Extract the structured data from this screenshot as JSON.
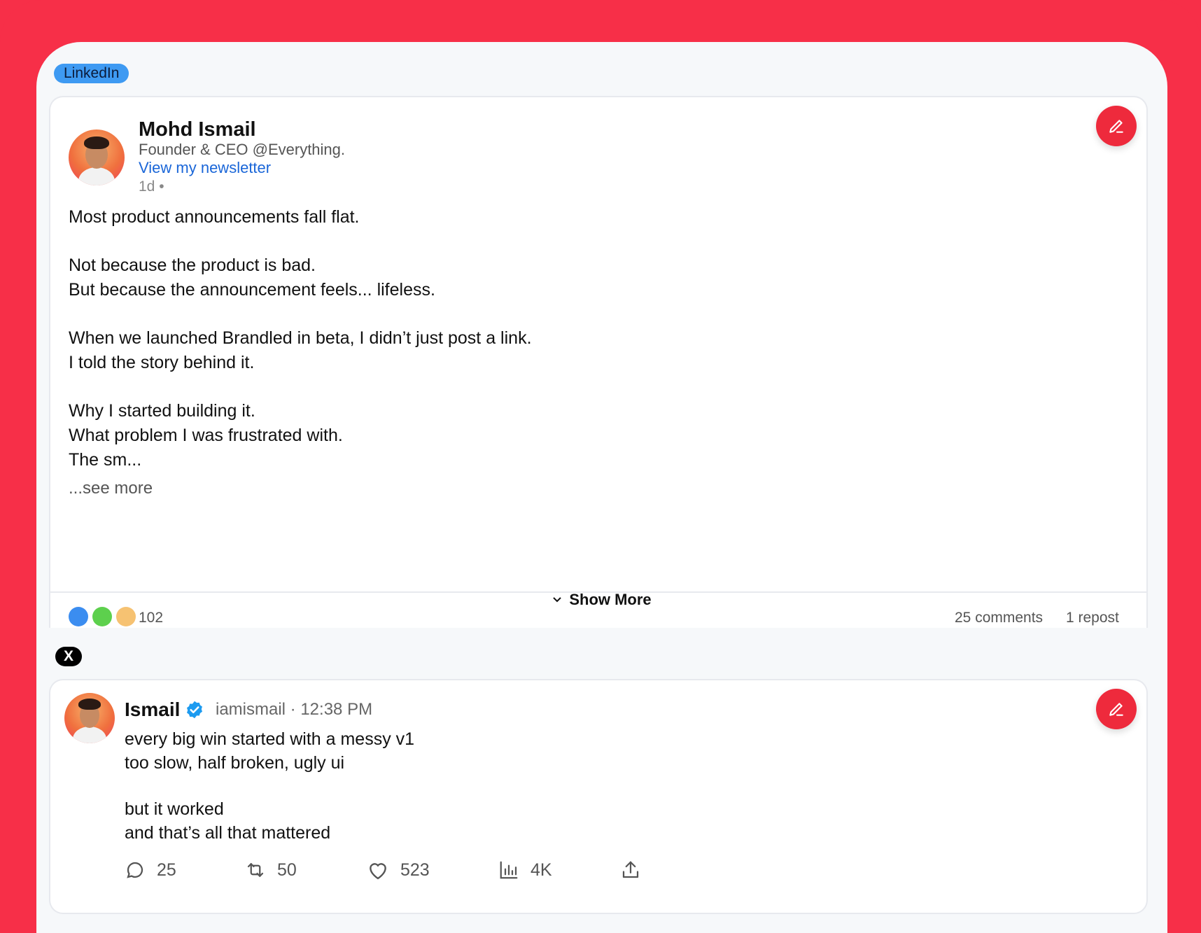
{
  "linkedin": {
    "badge": "LinkedIn",
    "author": "Mohd Ismail",
    "headline": "Founder & CEO @Everything.",
    "newsletter_link": "View my newsletter",
    "time": "1d •",
    "body": [
      "Most product announcements fall flat.",
      "",
      "Not because the product is bad.",
      "But because the announcement feels... lifeless.",
      "",
      "When we launched Brandled in beta, I didn’t just post a link.",
      "I told the story behind it.",
      "",
      "Why I started building it.",
      "What problem I was frustrated with.",
      "The sm..."
    ],
    "see_more": "...see more",
    "reactions_count": "102",
    "comments": "25 comments",
    "reposts": "1 repost",
    "reaction_colors": [
      "#3B8DF0",
      "#5DD04D",
      "#F6C272"
    ]
  },
  "show_more": "Show More",
  "x_post": {
    "badge": "X",
    "author": "Ismail",
    "handle_time": "iamismail · 12:38 PM",
    "body": [
      "every big win started with a messy v1",
      "too slow, half broken, ugly ui",
      "",
      "but it worked",
      "and that’s all that mattered"
    ],
    "replies": "25",
    "reposts": "50",
    "likes": "523",
    "views": "4K"
  },
  "colors": {
    "frame": "#F72F48",
    "accent_edit": "#EE2A3C",
    "link": "#1A66D8",
    "verified": "#1D9BF0"
  }
}
